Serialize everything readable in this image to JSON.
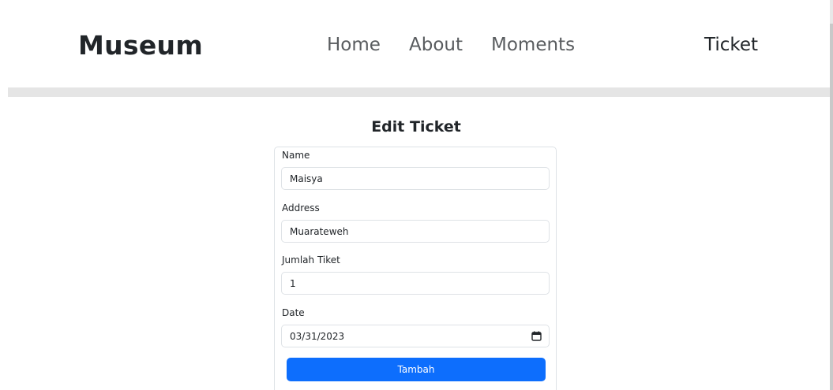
{
  "navbar": {
    "brand": "Museum",
    "links": [
      {
        "label": "Home"
      },
      {
        "label": "About"
      },
      {
        "label": "Moments"
      },
      {
        "label": "Ticket"
      }
    ]
  },
  "form": {
    "title": "Edit Ticket",
    "fields": {
      "name": {
        "label": "Name",
        "value": "Maisya"
      },
      "address": {
        "label": "Address",
        "value": "Muarateweh"
      },
      "jumlah": {
        "label": "Jumlah Tiket",
        "value": "1"
      },
      "date": {
        "label": "Date",
        "value": "03/31/2023"
      }
    },
    "submit_label": "Tambah"
  },
  "colors": {
    "primary": "#0d6efd",
    "text": "#212529",
    "nav_text": "#595c5f",
    "border": "#dee2e6",
    "band": "#e5e5e5"
  },
  "icons": {
    "date_picker": "calendar-icon"
  }
}
